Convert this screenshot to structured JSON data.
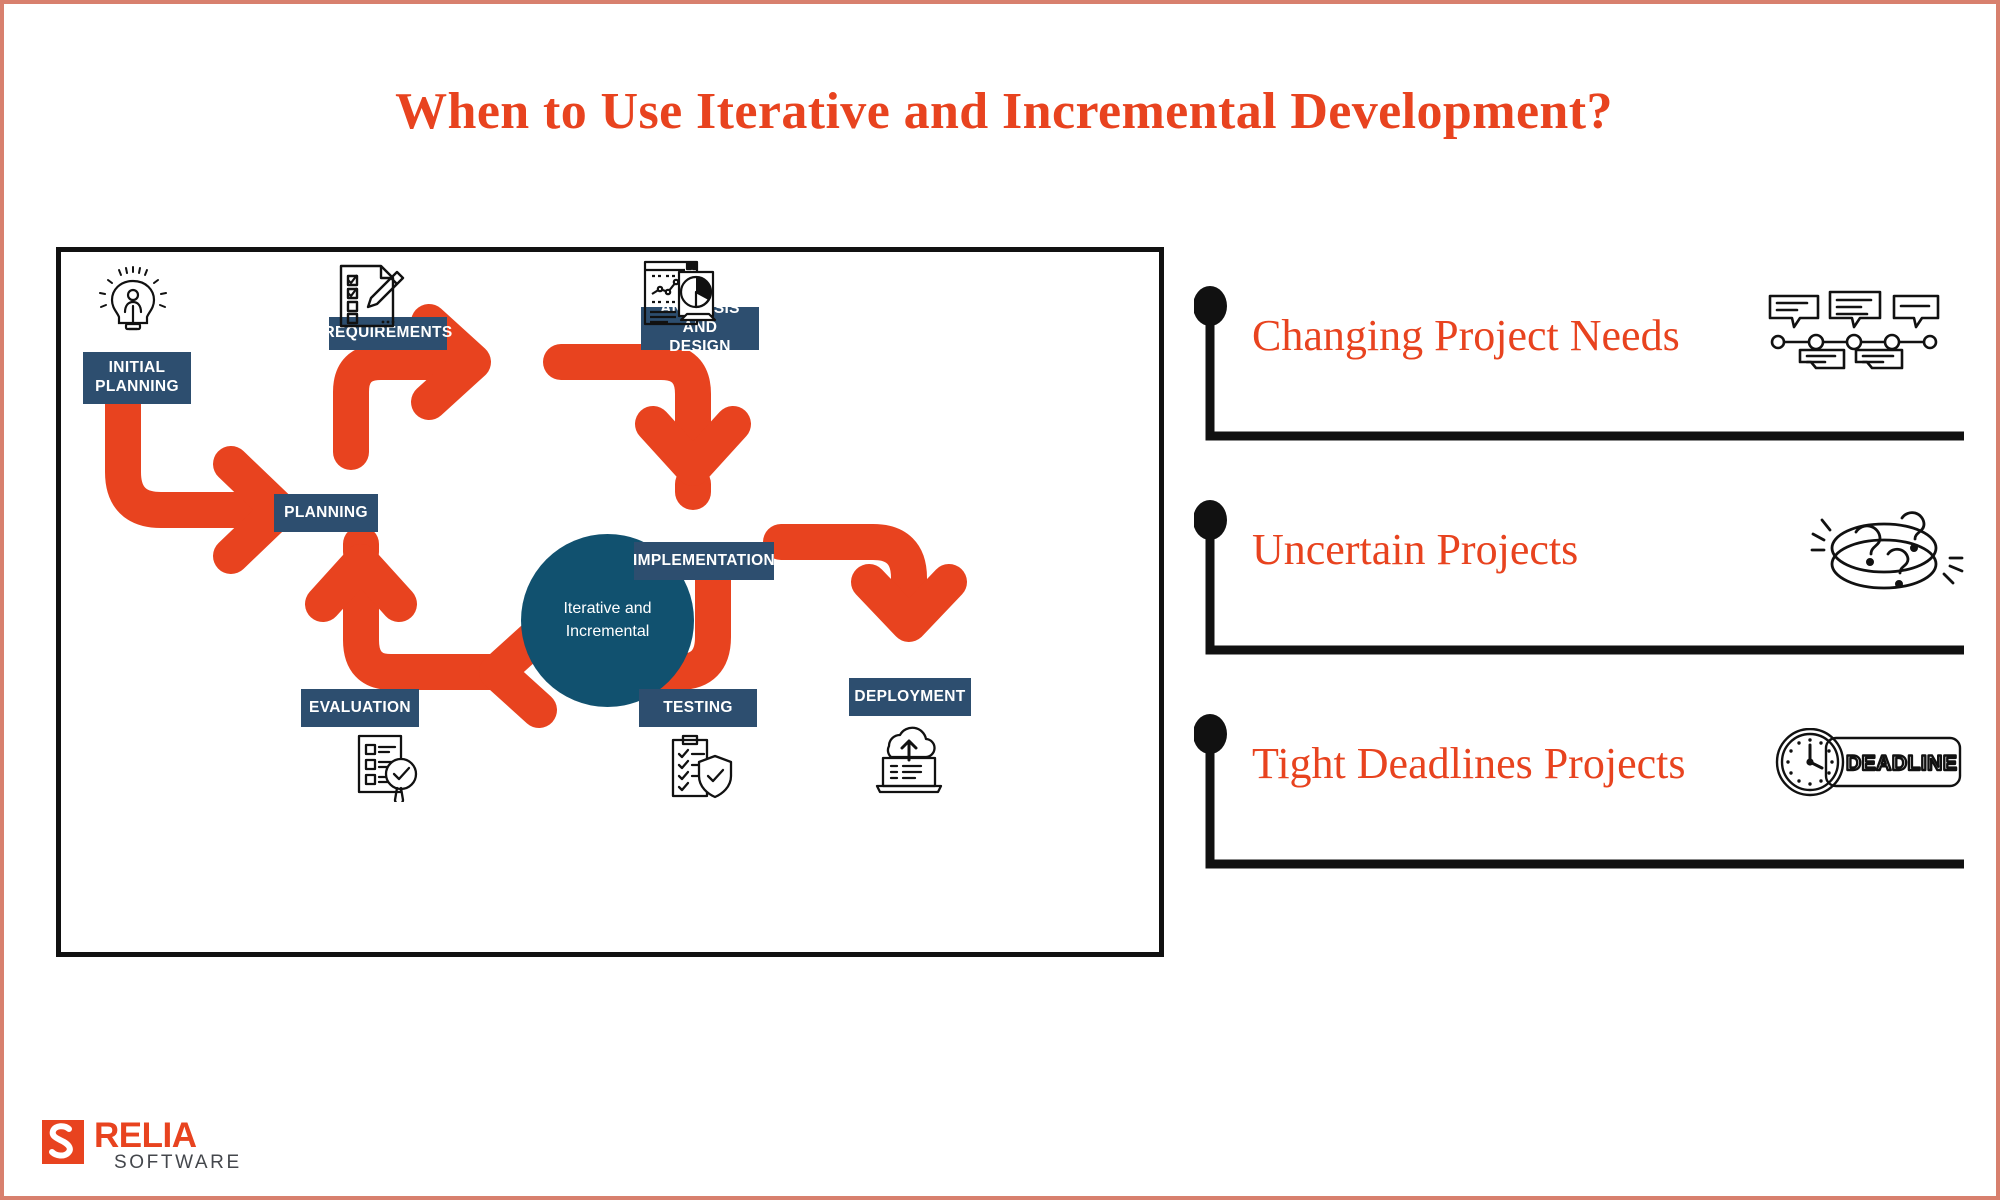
{
  "page": {
    "title": "When to Use Iterative and Incremental Development?",
    "accent_orange": "#e8431f",
    "chip_navy": "#2d4e6f",
    "circle_teal": "#11516f",
    "frame_border": "#111111",
    "outer_border": "#d8806e"
  },
  "diagram": {
    "center_circle": {
      "line1": "Iterative and",
      "line2": "Incremental"
    },
    "stages": [
      {
        "id": "initial-planning",
        "label_line1": "INITIAL",
        "label_line2": "PLANNING",
        "icon": "lightbulb-person-icon"
      },
      {
        "id": "requirements",
        "label_line1": "REQUIREMENTS",
        "label_line2": "",
        "icon": "checklist-pencil-icon"
      },
      {
        "id": "analysis-and-design",
        "label_line1": "ANALYSIS AND",
        "label_line2": "DESIGN",
        "icon": "charts-document-icon"
      },
      {
        "id": "planning",
        "label_line1": "PLANNING",
        "label_line2": "",
        "icon": ""
      },
      {
        "id": "implementation",
        "label_line1": "IMPLEMENTATION",
        "label_line2": "",
        "icon": ""
      },
      {
        "id": "deployment",
        "label_line1": "DEPLOYMENT",
        "label_line2": "",
        "icon": "cloud-upload-laptop-icon"
      },
      {
        "id": "testing",
        "label_line1": "TESTING",
        "label_line2": "",
        "icon": "clipboard-shield-icon"
      },
      {
        "id": "evaluation",
        "label_line1": "EVALUATION",
        "label_line2": "",
        "icon": "checklist-magnifier-icon"
      }
    ]
  },
  "right_list": {
    "items": [
      {
        "label": "Changing Project Needs",
        "icon": "chat-bubbles-timeline-icon"
      },
      {
        "label": "Uncertain Projects",
        "icon": "question-marks-swirl-icon"
      },
      {
        "label": "Tight Deadlines Projects",
        "icon": "clock-deadline-icon"
      }
    ]
  },
  "logo": {
    "name": "RELIA",
    "subtitle": "SOFTWARE"
  }
}
